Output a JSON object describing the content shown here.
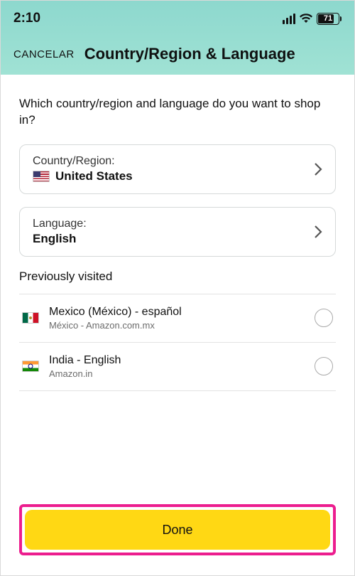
{
  "status": {
    "time": "2:10",
    "battery": "71"
  },
  "header": {
    "cancel": "CANCELAR",
    "title": "Country/Region & Language"
  },
  "prompt": "Which country/region and language do you want to shop in?",
  "countryCard": {
    "label": "Country/Region:",
    "value": "United States"
  },
  "languageCard": {
    "label": "Language:",
    "value": "English"
  },
  "prevVisitedTitle": "Previously visited",
  "prev": [
    {
      "title": "Mexico (México) - español",
      "sub": "México - Amazon.com.mx"
    },
    {
      "title": "India - English",
      "sub": "Amazon.in"
    }
  ],
  "doneLabel": "Done"
}
